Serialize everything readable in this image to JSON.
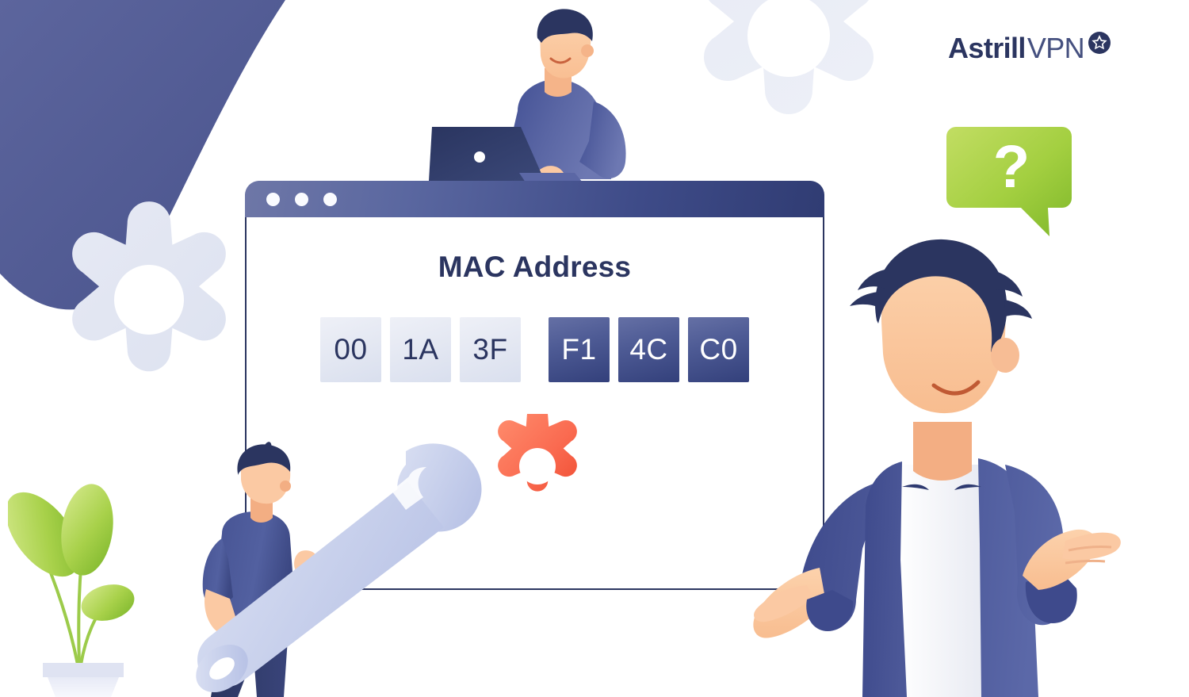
{
  "brand": {
    "name_bold": "Astrill",
    "name_light": "VPN",
    "mark_icon": "star-in-circle-icon"
  },
  "window": {
    "dots": [
      "close-dot",
      "minimize-dot",
      "maximize-dot"
    ],
    "title": "MAC Address",
    "octets": [
      {
        "value": "00",
        "style": "light"
      },
      {
        "value": "1A",
        "style": "light"
      },
      {
        "value": "3F",
        "style": "light"
      },
      {
        "value": "F1",
        "style": "dark"
      },
      {
        "value": "4C",
        "style": "dark"
      },
      {
        "value": "C0",
        "style": "dark"
      }
    ]
  },
  "illustration": {
    "question_bubble": {
      "glyph": "?",
      "icon": "question-mark-speech-bubble-icon"
    },
    "characters": [
      {
        "name": "person-at-laptop",
        "device_icon": "laptop-icon"
      },
      {
        "name": "person-with-wrench",
        "tool_icon": "wrench-icon"
      },
      {
        "name": "shrugging-person"
      }
    ],
    "decorations": [
      "background-curve-shape",
      "gear-icon-large-left",
      "gear-icon-top-center",
      "gear-icon-orange",
      "potted-plant-icon"
    ]
  },
  "colors": {
    "brand_navy": "#2b3560",
    "curve_blue": "#525c96",
    "tile_dark": "#3e4b88",
    "tile_light": "#e3e7f2",
    "accent_orange": "#fa6b51",
    "accent_green": "#9ecb3b",
    "gear_pale": "#e2e6f2",
    "skin": "#fbc9a3",
    "shirt_blue": "#4a5590"
  }
}
